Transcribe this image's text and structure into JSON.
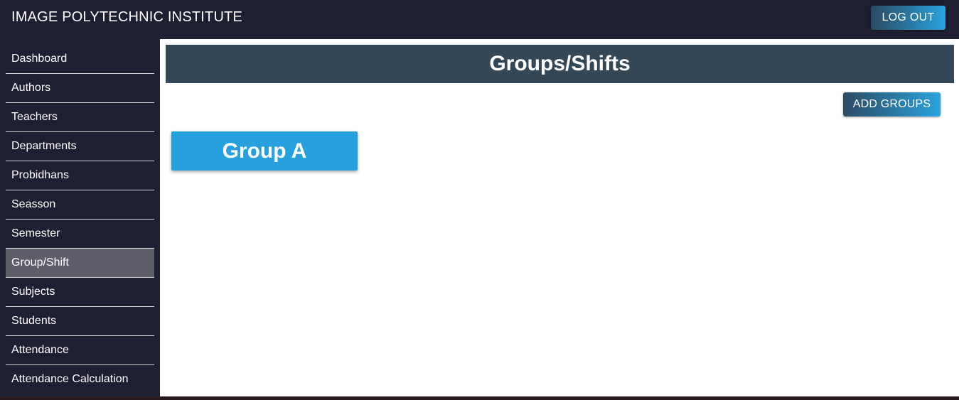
{
  "header": {
    "app_title": "IMAGE POLYTECHNIC INSTITUTE",
    "logout_label": "LOG OUT"
  },
  "sidebar": {
    "items": [
      {
        "label": "Dashboard"
      },
      {
        "label": "Authors"
      },
      {
        "label": "Teachers"
      },
      {
        "label": "Departments"
      },
      {
        "label": "Probidhans"
      },
      {
        "label": "Seasson"
      },
      {
        "label": "Semester"
      },
      {
        "label": "Group/Shift"
      },
      {
        "label": "Subjects"
      },
      {
        "label": "Students"
      },
      {
        "label": "Attendance"
      },
      {
        "label": "Attendance Calculation"
      }
    ],
    "active": "Group/Shift"
  },
  "main": {
    "page_title": "Groups/Shifts",
    "add_groups_label": "ADD GROUPS",
    "groups": [
      {
        "name": "Group A"
      }
    ]
  },
  "colors": {
    "background": "#1f1f33",
    "header_bar": "#334756",
    "accent": "#27a1dd",
    "active_item": "#5e5e6a"
  }
}
